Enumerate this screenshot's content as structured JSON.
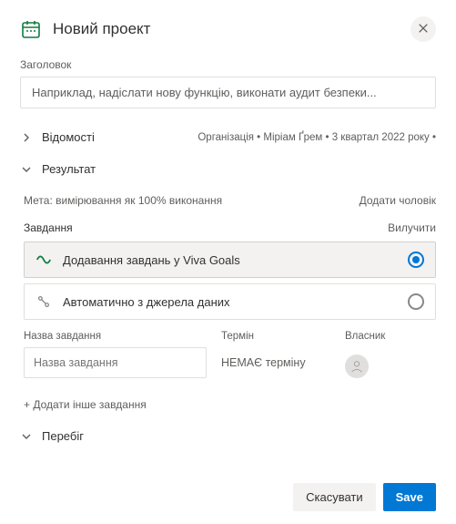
{
  "header": {
    "title": "Новий проект"
  },
  "title_field": {
    "label": "Заголовок",
    "placeholder": "Наприклад, надіслати нову функцію, виконати аудит безпеки..."
  },
  "details": {
    "label": "Відомості",
    "meta": "Організація • Міріам Ґрем • 3 квартал 2022 року •"
  },
  "result": {
    "label": "Результат",
    "goal_meta": "Мета: вимірювання як 100% виконання",
    "add_numeric": "Додати чоловік"
  },
  "tasks": {
    "header_label": "Завдання",
    "remove_label": "Вилучити",
    "options": [
      {
        "label": "Додавання завдань у Viva Goals",
        "selected": true
      },
      {
        "label": "Автоматично з джерела даних",
        "selected": false
      }
    ],
    "name_label": "Назва завдання",
    "name_placeholder": "Назва завдання",
    "due_label": "Термін",
    "due_value": "НЕМАЄ терміну",
    "owner_label": "Власник",
    "add_another": "+ Додати інше завдання"
  },
  "progress": {
    "label": "Перебіг"
  },
  "footer": {
    "cancel": "Скасувати",
    "save": "Save"
  }
}
